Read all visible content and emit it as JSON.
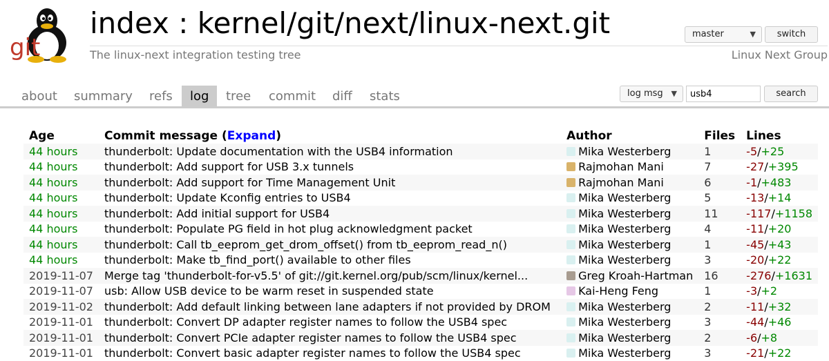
{
  "header": {
    "title": "index : kernel/git/next/linux-next.git",
    "subtitle": "The linux-next integration testing tree",
    "owner": "Linux Next Group",
    "logo_text": "git",
    "branch": "master",
    "switch_label": "switch"
  },
  "tabs": [
    {
      "label": "about"
    },
    {
      "label": "summary"
    },
    {
      "label": "refs"
    },
    {
      "label": "log",
      "active": true
    },
    {
      "label": "tree"
    },
    {
      "label": "commit"
    },
    {
      "label": "diff"
    },
    {
      "label": "stats"
    }
  ],
  "search": {
    "mode": "log msg",
    "query": "usb4",
    "button_label": "search"
  },
  "table": {
    "headers": {
      "age": "Age",
      "message_prefix": "Commit message (",
      "expand": "Expand",
      "message_suffix": ")",
      "author": "Author",
      "files": "Files",
      "lines": "Lines"
    },
    "rows": [
      {
        "age": "44 hours",
        "recent": true,
        "message": "thunderbolt: Update documentation with the USB4 information",
        "author": "Mika Westerberg",
        "avatar_color": "#d9f0f0",
        "files": "1",
        "del": "-5",
        "add": "+25"
      },
      {
        "age": "44 hours",
        "recent": true,
        "message": "thunderbolt: Add support for USB 3.x tunnels",
        "author": "Rajmohan Mani",
        "avatar_color": "#d9b36a",
        "files": "7",
        "del": "-27",
        "add": "+395"
      },
      {
        "age": "44 hours",
        "recent": true,
        "message": "thunderbolt: Add support for Time Management Unit",
        "author": "Rajmohan Mani",
        "avatar_color": "#d9b36a",
        "files": "6",
        "del": "-1",
        "add": "+483"
      },
      {
        "age": "44 hours",
        "recent": true,
        "message": "thunderbolt: Update Kconfig entries to USB4",
        "author": "Mika Westerberg",
        "avatar_color": "#d9f0f0",
        "files": "5",
        "del": "-13",
        "add": "+14"
      },
      {
        "age": "44 hours",
        "recent": true,
        "message": "thunderbolt: Add initial support for USB4",
        "author": "Mika Westerberg",
        "avatar_color": "#d9f0f0",
        "files": "11",
        "del": "-117",
        "add": "+1158"
      },
      {
        "age": "44 hours",
        "recent": true,
        "message": "thunderbolt: Populate PG field in hot plug acknowledgment packet",
        "author": "Mika Westerberg",
        "avatar_color": "#d9f0f0",
        "files": "4",
        "del": "-11",
        "add": "+20"
      },
      {
        "age": "44 hours",
        "recent": true,
        "message": "thunderbolt: Call tb_eeprom_get_drom_offset() from tb_eeprom_read_n()",
        "author": "Mika Westerberg",
        "avatar_color": "#d9f0f0",
        "files": "1",
        "del": "-45",
        "add": "+43"
      },
      {
        "age": "44 hours",
        "recent": true,
        "message": "thunderbolt: Make tb_find_port() available to other files",
        "author": "Mika Westerberg",
        "avatar_color": "#d9f0f0",
        "files": "3",
        "del": "-20",
        "add": "+22"
      },
      {
        "age": "2019-11-07",
        "recent": false,
        "message": "Merge tag 'thunderbolt-for-v5.5' of git://git.kernel.org/pub/scm/linux/kernel...",
        "author": "Greg Kroah-Hartman",
        "avatar_color": "#a89c90",
        "files": "16",
        "del": "-276",
        "add": "+1631"
      },
      {
        "age": "2019-11-07",
        "recent": false,
        "message": "usb: Allow USB device to be warm reset in suspended state",
        "author": "Kai-Heng Feng",
        "avatar_color": "#e6c8e6",
        "files": "1",
        "del": "-3",
        "add": "+2"
      },
      {
        "age": "2019-11-02",
        "recent": false,
        "message": "thunderbolt: Add default linking between lane adapters if not provided by DROM",
        "author": "Mika Westerberg",
        "avatar_color": "#d9f0f0",
        "files": "2",
        "del": "-11",
        "add": "+32"
      },
      {
        "age": "2019-11-01",
        "recent": false,
        "message": "thunderbolt: Convert DP adapter register names to follow the USB4 spec",
        "author": "Mika Westerberg",
        "avatar_color": "#d9f0f0",
        "files": "3",
        "del": "-44",
        "add": "+46"
      },
      {
        "age": "2019-11-01",
        "recent": false,
        "message": "thunderbolt: Convert PCIe adapter register names to follow the USB4 spec",
        "author": "Mika Westerberg",
        "avatar_color": "#d9f0f0",
        "files": "2",
        "del": "-6",
        "add": "+8"
      },
      {
        "age": "2019-11-01",
        "recent": false,
        "message": "thunderbolt: Convert basic adapter register names to follow the USB4 spec",
        "author": "Mika Westerberg",
        "avatar_color": "#d9f0f0",
        "files": "3",
        "del": "-21",
        "add": "+22"
      }
    ]
  }
}
